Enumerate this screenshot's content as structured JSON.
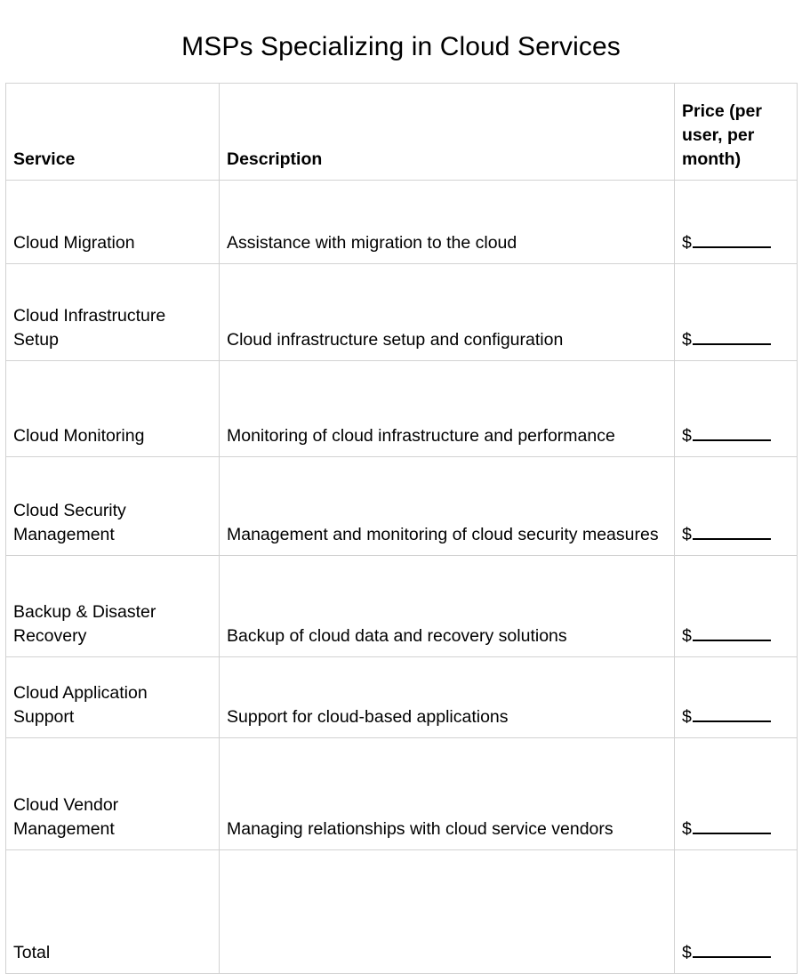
{
  "document": {
    "title": "MSPs Specializing in Cloud Services"
  },
  "table": {
    "columns": [
      {
        "key": "service",
        "label": "Service"
      },
      {
        "key": "description",
        "label": "Description"
      },
      {
        "key": "price",
        "label": "Price (per user, per month)"
      }
    ],
    "price_prefix": "$",
    "rows": [
      {
        "service": "Cloud Migration",
        "description": "Assistance with migration to the cloud",
        "price": "$"
      },
      {
        "service": "Cloud Infrastructure Setup",
        "description": "Cloud infrastructure setup and configuration",
        "price": "$"
      },
      {
        "service": "Cloud Monitoring",
        "description": "Monitoring of cloud infrastructure and performance",
        "price": "$"
      },
      {
        "service": "Cloud Security Management",
        "description": "Management and monitoring of cloud security measures",
        "price": "$"
      },
      {
        "service": "Backup & Disaster Recovery",
        "description": "Backup of cloud data and recovery solutions",
        "price": "$"
      },
      {
        "service": "Cloud Application Support",
        "description": "Support for cloud-based applications",
        "price": "$"
      },
      {
        "service": "Cloud Vendor Management",
        "description": "Managing relationships with cloud service vendors",
        "price": "$"
      },
      {
        "service": "Total",
        "description": "",
        "price": "$"
      }
    ]
  },
  "colors": {
    "text": "#000000",
    "border": "#d2d2d2",
    "background": "#ffffff"
  }
}
